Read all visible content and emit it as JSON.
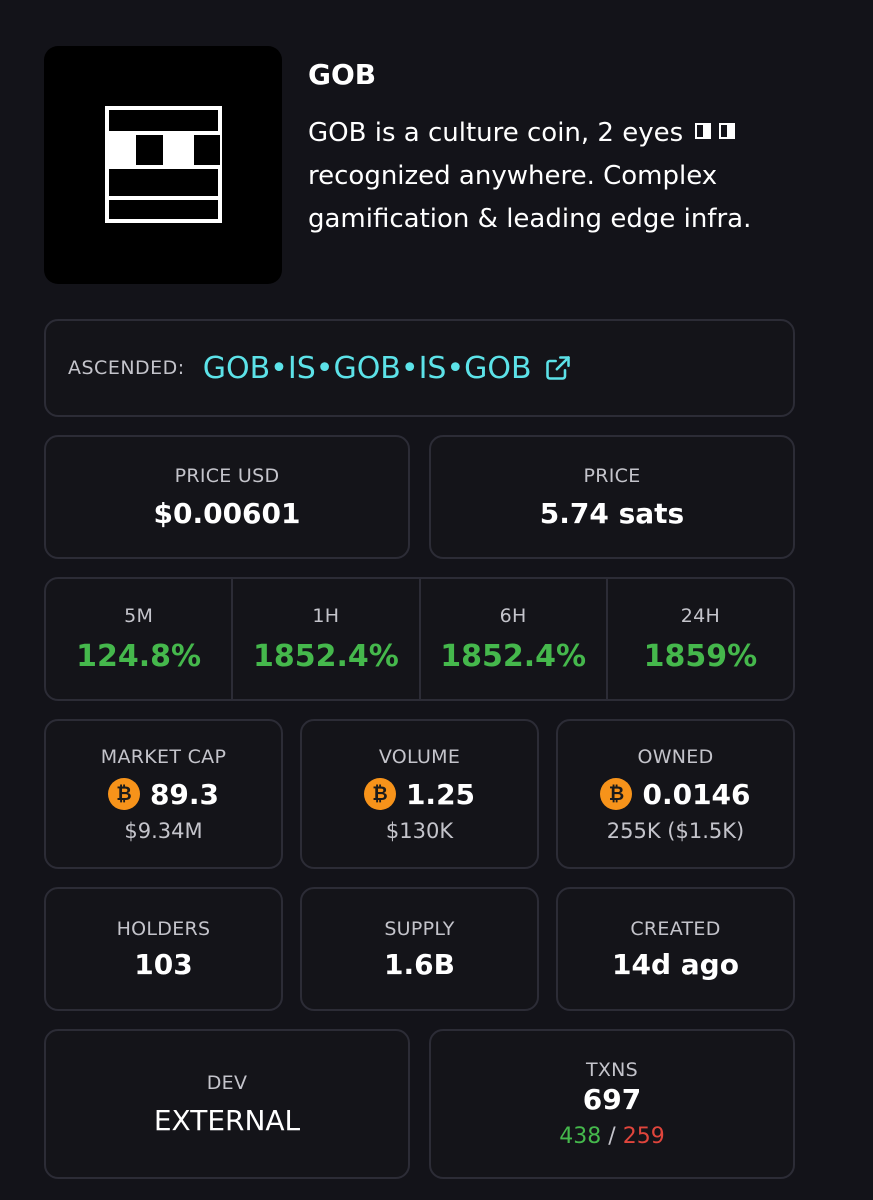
{
  "token": {
    "name": "GOB",
    "description_1": "GOB is a culture coin, 2 eyes",
    "description_2": "recognized anywhere. Complex gamification & leading edge infra."
  },
  "ascended": {
    "label": "ASCENDED:",
    "name": "GOB•IS•GOB•IS•GOB"
  },
  "price": {
    "usd_label": "PRICE USD",
    "usd_value": "$0.00601",
    "sats_label": "PRICE",
    "sats_value": "5.74 sats"
  },
  "changes": [
    {
      "label": "5M",
      "value": "124.8%"
    },
    {
      "label": "1H",
      "value": "1852.4%"
    },
    {
      "label": "6H",
      "value": "1852.4%"
    },
    {
      "label": "24H",
      "value": "1859%"
    }
  ],
  "stats": {
    "market_cap": {
      "label": "MARKET CAP",
      "btc": "89.3",
      "usd": "$9.34M"
    },
    "volume": {
      "label": "VOLUME",
      "btc": "1.25",
      "usd": "$130K"
    },
    "owned": {
      "label": "OWNED",
      "btc": "0.0146",
      "usd": "255K ($1.5K)"
    },
    "holders": {
      "label": "HOLDERS",
      "value": "103"
    },
    "supply": {
      "label": "SUPPLY",
      "value": "1.6B"
    },
    "created": {
      "label": "CREATED",
      "value": "14d ago"
    },
    "dev": {
      "label": "DEV",
      "value": "EXTERNAL"
    },
    "txns": {
      "label": "TXNS",
      "total": "697",
      "buys": "438",
      "separator": "/",
      "sells": "259"
    }
  },
  "icons": {
    "bitcoin": "bitcoin-icon",
    "external_link": "external-link-icon"
  },
  "colors": {
    "background": "#131319",
    "positive": "#45b84c",
    "negative": "#e0453c",
    "link": "#5ce2e8",
    "bitcoin": "#f7931a"
  }
}
